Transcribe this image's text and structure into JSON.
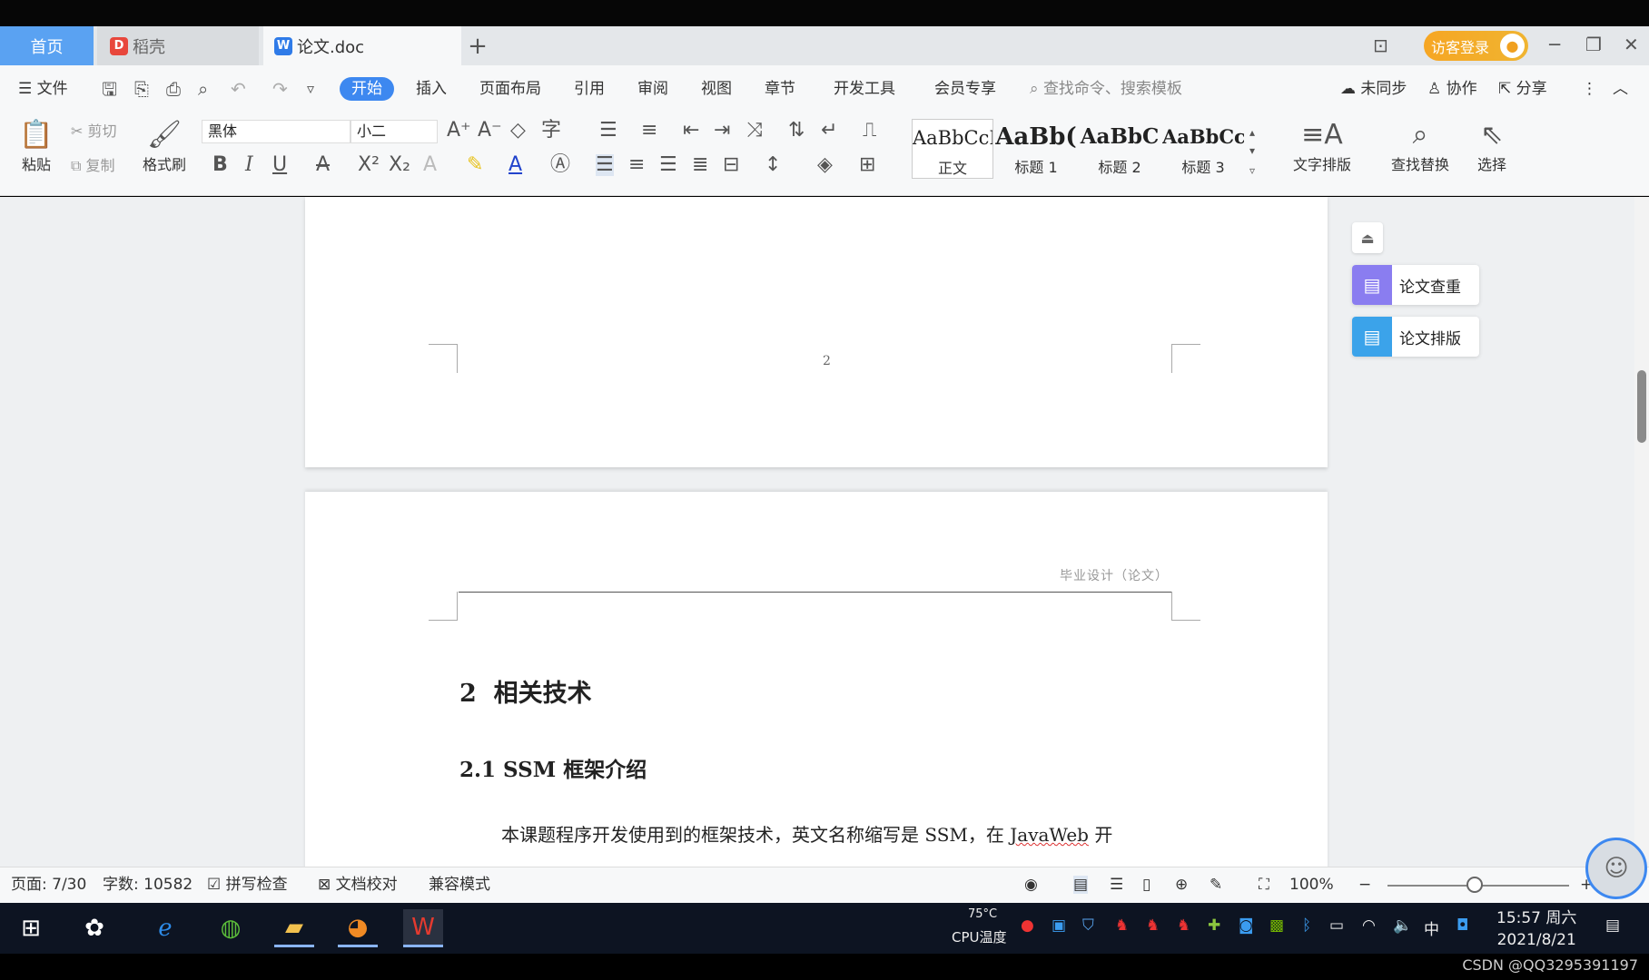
{
  "tabs": {
    "home": "首页",
    "daoke": "稻壳",
    "doc": "论文.doc",
    "new_tab": "+"
  },
  "titlebar": {
    "login": "访客登录",
    "minimize": "─",
    "restore": "❐",
    "close": "✕"
  },
  "menu": {
    "file": "文件",
    "items": [
      "开始",
      "插入",
      "页面布局",
      "引用",
      "审阅",
      "视图",
      "章节",
      "开发工具",
      "会员专享"
    ],
    "search_placeholder": "查找命令、搜索模板",
    "sync": "未同步",
    "collab": "协作",
    "share": "分享"
  },
  "ribbon": {
    "paste": "粘贴",
    "cut": "剪切",
    "copy": "复制",
    "format_painter": "格式刷",
    "font": "黑体",
    "size": "小二",
    "styles": [
      {
        "preview": "AaBbCcI",
        "label": "正文"
      },
      {
        "preview": "AaBb(",
        "label": "标题 1"
      },
      {
        "preview": "AaBbC",
        "label": "标题 2"
      },
      {
        "preview": "AaBbCcI",
        "label": "标题 3"
      }
    ],
    "text_layout": "文字排版",
    "find_replace": "查找替换",
    "select": "选择"
  },
  "document": {
    "page_number": "2",
    "header_text": "毕业设计（论文）",
    "heading1": "2  相关技术",
    "heading2": "2.1 SSM 框架介绍",
    "body_start": "本课题程序开发使用到的框架技术，英文名称缩写是 SSM，在 ",
    "body_underlined": "JavaWeb",
    "body_end": " 开"
  },
  "side_panel": {
    "check": "论文查重",
    "layout": "论文排版"
  },
  "status": {
    "page": "页面: 7/30",
    "words": "字数: 10582",
    "spell": "拼写检查",
    "proof": "文档校对",
    "compat": "兼容模式",
    "zoom": "100%"
  },
  "taskbar": {
    "cpu_temp": "75°C",
    "cpu_label": "CPU温度",
    "ime": "中",
    "time": "15:57 周六",
    "date": "2021/8/21"
  },
  "watermark": "CSDN @QQ3295391197",
  "colors": {
    "accent": "#3d88f0",
    "login": "#f6a623",
    "tab_home": "#5aa2f2"
  }
}
